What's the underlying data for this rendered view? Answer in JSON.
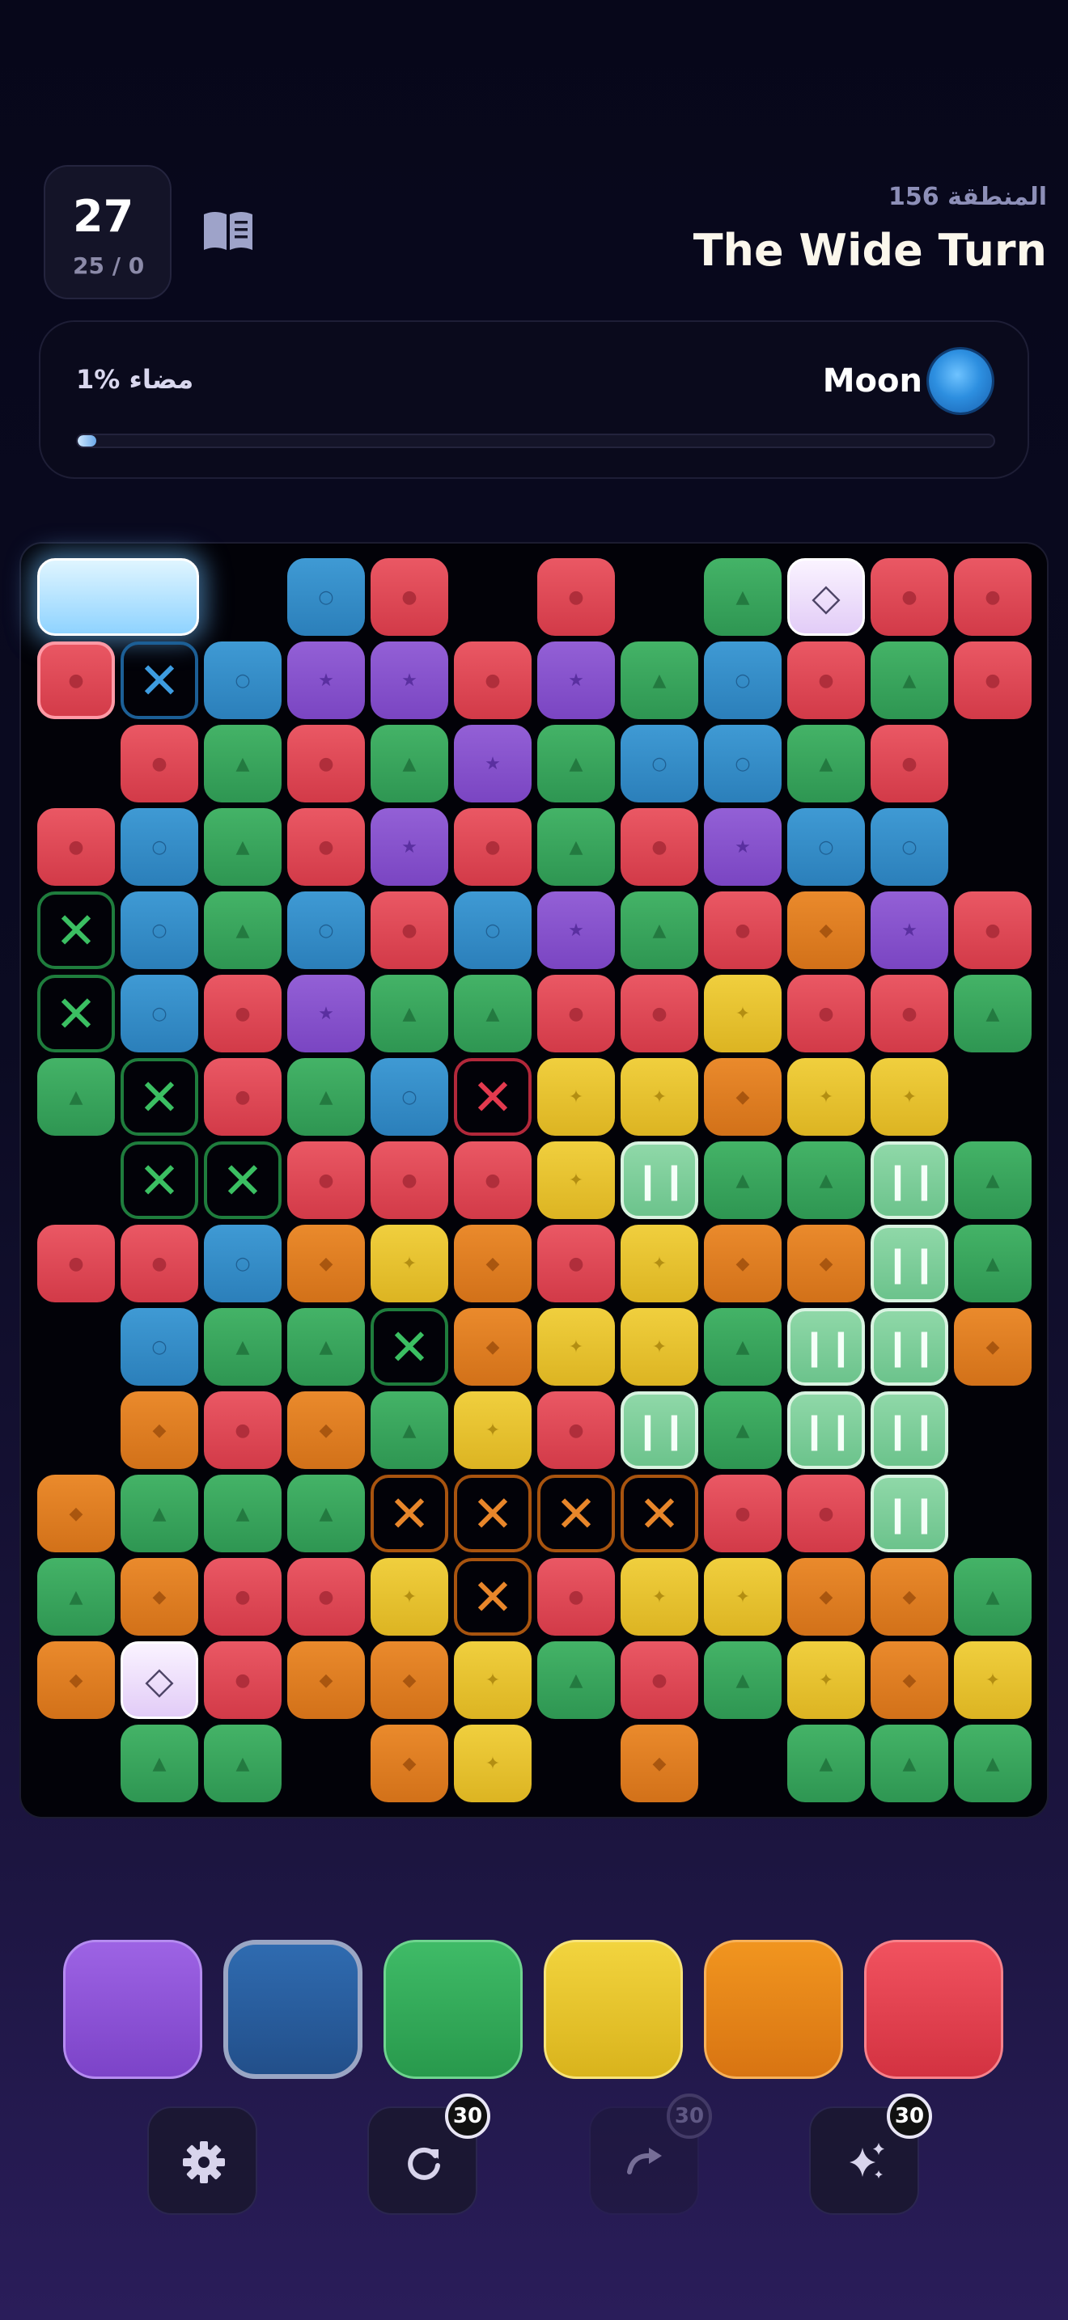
{
  "header": {
    "moves_left": "27",
    "progress_count": "25 / 0",
    "zone_label": "المنطقة 156",
    "level_title": "The Wide Turn",
    "book_icon": "book-icon"
  },
  "progress": {
    "light_label": "1% مضاء",
    "percent": 1,
    "target_name": "Moon",
    "target_icon": "moon-orb-icon"
  },
  "board": {
    "columns": 12,
    "rows": 15,
    "legend": {
      "R": "red circle tile",
      "B": "blue ring tile",
      "G": "green triangle tile",
      "P": "purple star tile",
      "O": "orange diamond tile",
      "Y": "yellow sparkle tile",
      "xG": "cleared green marker",
      "xB": "cleared blue marker",
      "xR": "cleared red marker",
      "xO": "cleared orange marker",
      "PA": "paused tile",
      "D": "diamond special tile",
      "S": "spawn block",
      "": "empty"
    },
    "grid": [
      [
        "S",
        "S",
        "",
        "B",
        "R",
        "",
        "R",
        "",
        "G",
        "D",
        "R",
        "R"
      ],
      [
        "R*",
        "xB",
        "B",
        "P",
        "P",
        "R",
        "P",
        "G",
        "B",
        "R",
        "G",
        "R"
      ],
      [
        "",
        "R",
        "G",
        "R",
        "G",
        "P",
        "G",
        "B",
        "B",
        "G",
        "R",
        ""
      ],
      [
        "R",
        "B",
        "G",
        "R",
        "P",
        "R",
        "G",
        "R",
        "P",
        "B",
        "B",
        ""
      ],
      [
        "xG",
        "B",
        "G",
        "B",
        "R",
        "B",
        "P",
        "G",
        "R",
        "O",
        "P",
        "R"
      ],
      [
        "xG",
        "B",
        "R",
        "P",
        "G",
        "G",
        "R",
        "R",
        "Y",
        "R",
        "R",
        "G"
      ],
      [
        "G",
        "xG",
        "R",
        "G",
        "B",
        "xR",
        "Y",
        "Y",
        "O",
        "Y",
        "Y",
        ""
      ],
      [
        "",
        "xG",
        "xG",
        "R",
        "R",
        "R",
        "Y",
        "PA",
        "G",
        "G",
        "PA",
        "G"
      ],
      [
        "R",
        "R",
        "B",
        "O",
        "Y",
        "O",
        "R",
        "Y",
        "O",
        "O",
        "PA",
        "G"
      ],
      [
        "",
        "B",
        "G",
        "G",
        "xG",
        "O",
        "Y",
        "Y",
        "G",
        "PA",
        "PA",
        "O"
      ],
      [
        "",
        "O",
        "R",
        "O",
        "G",
        "Y",
        "R",
        "PA",
        "G",
        "PA",
        "PA",
        ""
      ],
      [
        "O",
        "G",
        "G",
        "G",
        "xO",
        "xO",
        "xO",
        "xO",
        "R",
        "R",
        "PA",
        ""
      ],
      [
        "G",
        "O",
        "R",
        "R",
        "Y",
        "xO",
        "R",
        "Y",
        "Y",
        "O",
        "O",
        "G"
      ],
      [
        "O",
        "D",
        "R",
        "O",
        "O",
        "Y",
        "G",
        "R",
        "G",
        "Y",
        "O",
        "Y"
      ],
      [
        "",
        "G",
        "G",
        "",
        "O",
        "Y",
        "",
        "O",
        "",
        "G",
        "G",
        "G"
      ]
    ]
  },
  "palette": {
    "colors": [
      "purple",
      "blue",
      "green",
      "yellow",
      "orange",
      "red"
    ],
    "selected": "blue"
  },
  "toolbar": {
    "settings_icon": "gear-icon",
    "undo_icon": "undo-icon",
    "undo_count": "30",
    "redo_icon": "redo-icon",
    "redo_count": "30",
    "hint_icon": "sparkles-icon",
    "hint_count": "30"
  }
}
